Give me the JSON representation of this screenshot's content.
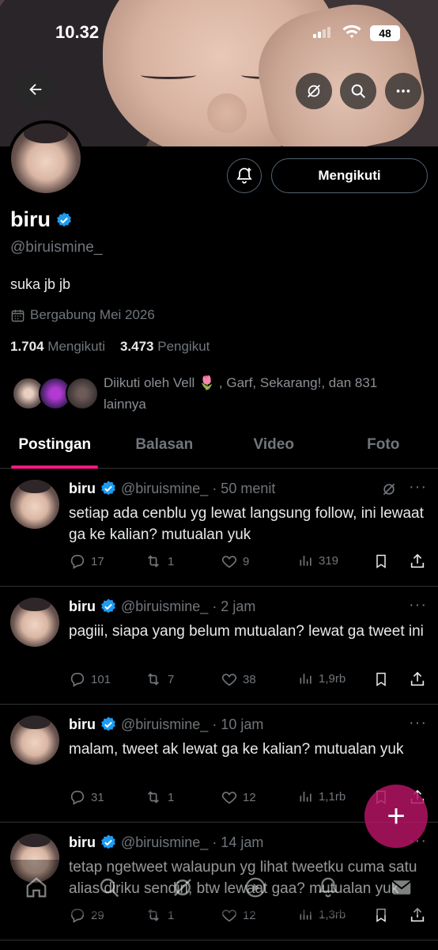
{
  "status_bar": {
    "time": "10.32",
    "battery": "48"
  },
  "profile": {
    "name": "biru",
    "handle": "@biruismine_",
    "bio": "suka jb jb",
    "joined": "Bergabung Mei 2026",
    "following_count": "1.704",
    "following_label": "Mengikuti",
    "followers_count": "3.473",
    "followers_label": "Pengikut",
    "follow_button": "Mengikuti",
    "followed_by": "Diikuti oleh Vell 🌷 , Garf, Sekarang!, dan 831 lainnya"
  },
  "tabs": [
    {
      "label": "Postingan",
      "active": true
    },
    {
      "label": "Balasan"
    },
    {
      "label": "Video"
    },
    {
      "label": "Foto"
    }
  ],
  "posts": [
    {
      "name": "biru",
      "handle": "@biruismine_",
      "time": "· 50 menit",
      "text": "setiap ada cenblu yg lewat langsung follow, ini lewaat ga ke kalian? mutualan yuk",
      "replies": "17",
      "reposts": "1",
      "likes": "9",
      "views": "319"
    },
    {
      "name": "biru",
      "handle": "@biruismine_",
      "time": "· 2 jam",
      "text": "pagiii, siapa yang belum mutualan? lewat ga tweet ini",
      "replies": "101",
      "reposts": "7",
      "likes": "38",
      "views": "1,9rb"
    },
    {
      "name": "biru",
      "handle": "@biruismine_",
      "time": "· 10 jam",
      "text": "malam, tweet ak lewat ga ke kalian? mutualan yuk",
      "replies": "31",
      "reposts": "1",
      "likes": "12",
      "views": "1,1rb"
    },
    {
      "name": "biru",
      "handle": "@biruismine_",
      "time": "· 14 jam",
      "text": "tetap ngetweet walaupun yg lihat tweetku cuma satu alias diriku sendiri, btw lewaat gaa? mutualan yuk",
      "replies": "29",
      "reposts": "1",
      "likes": "12",
      "views": "1,3rb"
    }
  ],
  "fab": {
    "label": "+"
  },
  "colors": {
    "accent": "#f91880",
    "verified": "#1d9bf0",
    "muted": "#71767b"
  }
}
